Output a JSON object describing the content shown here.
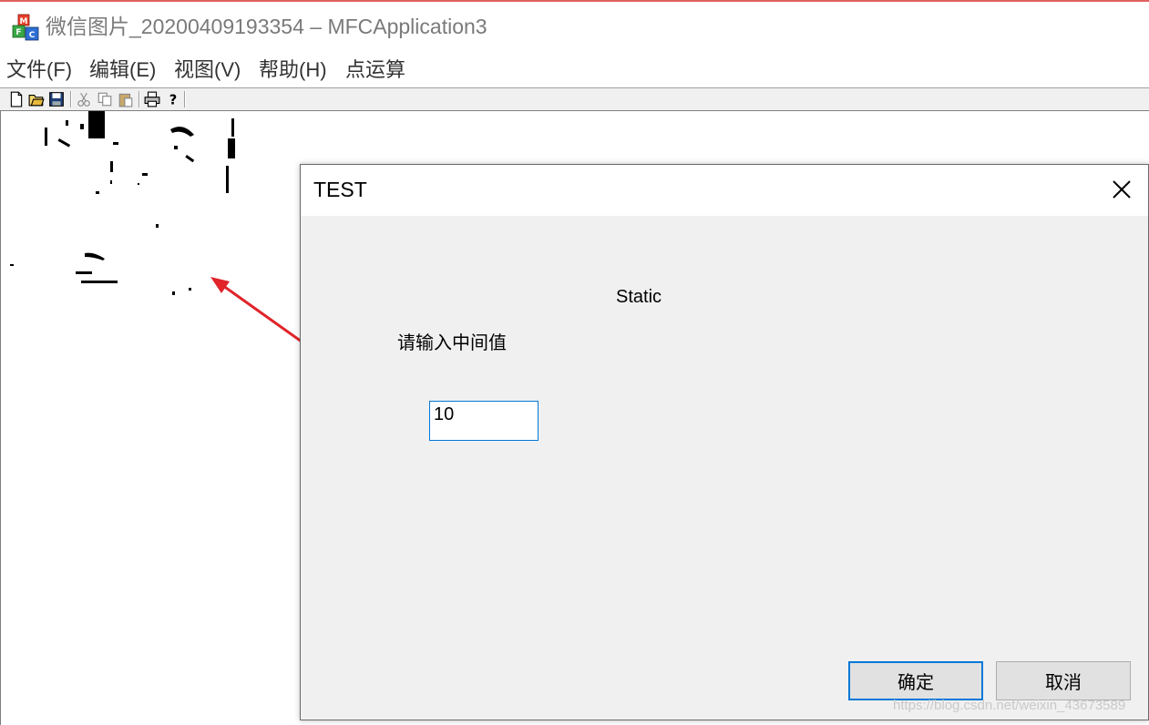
{
  "window": {
    "title": "微信图片_20200409193354 – MFCApplication3",
    "icon": "mfc-app-icon"
  },
  "menu": {
    "items": [
      "文件(F)",
      "编辑(E)",
      "视图(V)",
      "帮助(H)",
      "点运算"
    ]
  },
  "toolbar": {
    "buttons": [
      "new-file-icon",
      "open-folder-icon",
      "save-icon",
      "cut-icon",
      "copy-icon",
      "paste-icon",
      "print-icon",
      "help-icon"
    ]
  },
  "dialog": {
    "title": "TEST",
    "static_text": "Static",
    "prompt": "请输入中间值",
    "input_value": "10",
    "ok_label": "确定",
    "cancel_label": "取消"
  },
  "watermark": "https://blog.csdn.net/weixin_43673589",
  "colors": {
    "accent": "#0078d7",
    "dialog_bg": "#f0f0f0",
    "arrow": "#e0242a"
  }
}
